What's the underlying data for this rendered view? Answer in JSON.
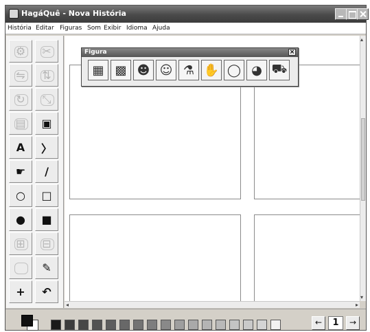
{
  "window": {
    "title": "HagáQuê - Nova História"
  },
  "menu": [
    "História",
    "Editar",
    "Figuras",
    "Som",
    "Exibir",
    "Idioma",
    "Ajuda"
  ],
  "toolbox": [
    {
      "name": "gear-tool",
      "glyph": "⚙",
      "enabled": false
    },
    {
      "name": "scissors-tool",
      "glyph": "✂",
      "enabled": false
    },
    {
      "name": "flip-horizontal-tool",
      "glyph": "⇋",
      "enabled": false
    },
    {
      "name": "flip-vertical-tool",
      "glyph": "⇅",
      "enabled": false
    },
    {
      "name": "rotate-tool",
      "glyph": "↻",
      "enabled": false
    },
    {
      "name": "resize-tool",
      "glyph": "⤡",
      "enabled": false
    },
    {
      "name": "layer-tool",
      "glyph": "▤",
      "enabled": false
    },
    {
      "name": "bucket-tool",
      "glyph": "▣",
      "enabled": true
    },
    {
      "name": "text-tool",
      "glyph": "A",
      "enabled": true
    },
    {
      "name": "arrow-tool",
      "glyph": "〉",
      "enabled": true
    },
    {
      "name": "paint-tool",
      "glyph": "☛",
      "enabled": true
    },
    {
      "name": "line-tool",
      "glyph": "/",
      "enabled": true
    },
    {
      "name": "circle-tool",
      "glyph": "○",
      "enabled": true
    },
    {
      "name": "rectangle-tool",
      "glyph": "□",
      "enabled": true
    },
    {
      "name": "filled-circle-tool",
      "glyph": "●",
      "enabled": true
    },
    {
      "name": "filled-rectangle-tool",
      "glyph": "■",
      "enabled": true
    },
    {
      "name": "layout-tool-a",
      "glyph": "⊞",
      "enabled": false
    },
    {
      "name": "layout-tool-b",
      "glyph": "⊟",
      "enabled": false
    },
    {
      "name": "blank-tool",
      "glyph": "",
      "enabled": false
    },
    {
      "name": "eraser-tool",
      "glyph": "✎",
      "enabled": true
    },
    {
      "name": "move-tool",
      "glyph": "+",
      "enabled": true
    },
    {
      "name": "undo-tool",
      "glyph": "↶",
      "enabled": true
    }
  ],
  "figura": {
    "title": "Figura",
    "close": "×",
    "buttons": [
      {
        "name": "scenery-icon",
        "glyph": "▦"
      },
      {
        "name": "object-icon",
        "glyph": "▩"
      },
      {
        "name": "characters-icon",
        "glyph": "☻"
      },
      {
        "name": "people-icon",
        "glyph": "☺"
      },
      {
        "name": "bottles-icon",
        "glyph": "⚗"
      },
      {
        "name": "hands-icon",
        "glyph": "✋"
      },
      {
        "name": "speech-balloon-icon",
        "glyph": "◯"
      },
      {
        "name": "palette-icon",
        "glyph": "◕"
      },
      {
        "name": "truck-icon",
        "glyph": "⛟"
      }
    ]
  },
  "palette": [
    "#1a1a1a",
    "#3c3c3c",
    "#474747",
    "#525252",
    "#5d5d5d",
    "#686868",
    "#737373",
    "#7e7e7e",
    "#898989",
    "#9e9e9e",
    "#a9a9a9",
    "#b4b4b4",
    "#b9b9b9",
    "#c4c4c4",
    "#c9c9c9",
    "#d4d4d4",
    "#f2f2f2"
  ],
  "colors": {
    "foreground": "#111111",
    "background": "#ffffff"
  },
  "pager": {
    "page": "1",
    "prev": "←",
    "next": "→"
  }
}
